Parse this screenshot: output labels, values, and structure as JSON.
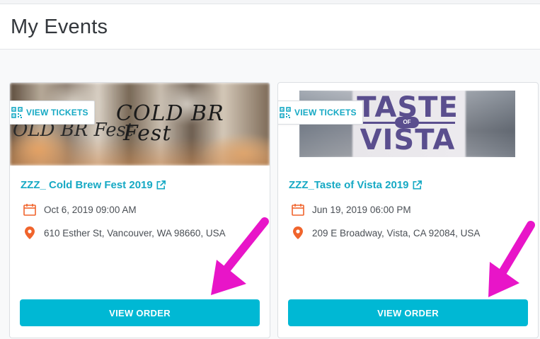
{
  "page": {
    "title": "My Events"
  },
  "colors": {
    "accent": "#16a9c4",
    "button": "#00b8d4",
    "icon": "#f0642c",
    "arrow": "#e815c8"
  },
  "events": [
    {
      "title": "ZZZ_ Cold Brew Fest 2019",
      "banner_text_1": "COLD BR",
      "banner_text_2": "Fest",
      "banner_text_3": "OLD BR Fest",
      "view_tickets": "VIEW TICKETS",
      "datetime": "Oct 6, 2019 09:00 AM",
      "address": "610 Esther St, Vancouver, WA 98660, USA",
      "view_order": "VIEW ORDER"
    },
    {
      "title": "ZZZ_Taste of Vista 2019",
      "banner_word_1": "TASTE",
      "banner_word_2": "OF",
      "banner_word_3": "VISTA",
      "view_tickets": "VIEW TICKETS",
      "datetime": "Jun 19, 2019 06:00 PM",
      "address": "209 E Broadway, Vista, CA 92084, USA",
      "view_order": "VIEW ORDER"
    }
  ]
}
